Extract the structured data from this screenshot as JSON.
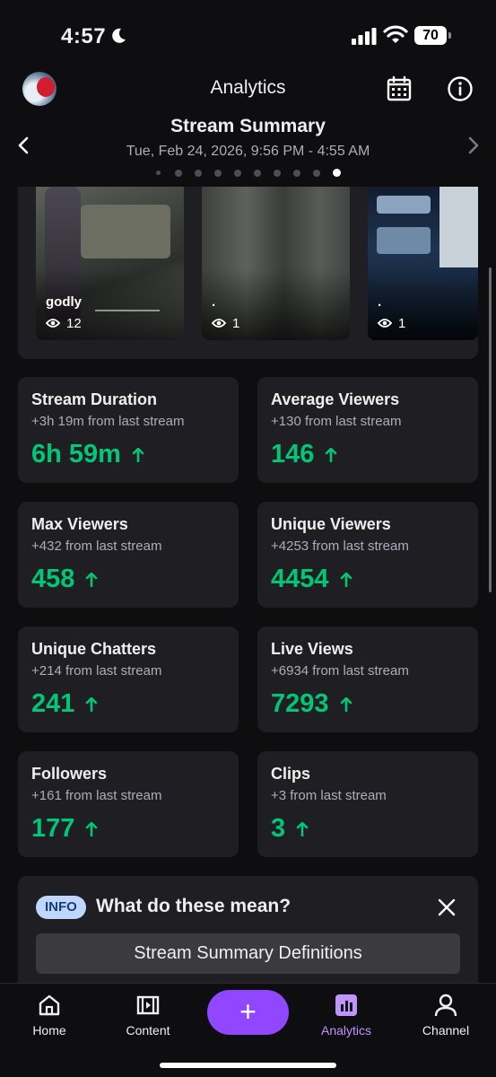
{
  "status_bar": {
    "time": "4:57",
    "battery": "70"
  },
  "header": {
    "title": "Analytics"
  },
  "summary": {
    "title": "Stream Summary",
    "date_range": "Tue, Feb 24, 2026, 9:56 PM - 4:55 AM",
    "page_count": 10,
    "active_page": 9
  },
  "clips": [
    {
      "caption": "godly",
      "views": "12"
    },
    {
      "caption": ".",
      "views": "1"
    },
    {
      "caption": ".",
      "views": "1"
    }
  ],
  "stats": [
    {
      "label": "Stream Duration",
      "delta": "+3h 19m from last stream",
      "value": "6h 59m"
    },
    {
      "label": "Average Viewers",
      "delta": "+130 from last stream",
      "value": "146"
    },
    {
      "label": "Max Viewers",
      "delta": "+432 from last stream",
      "value": "458"
    },
    {
      "label": "Unique Viewers",
      "delta": "+4253 from last stream",
      "value": "4454"
    },
    {
      "label": "Unique Chatters",
      "delta": "+214 from last stream",
      "value": "241"
    },
    {
      "label": "Live Views",
      "delta": "+6934 from last stream",
      "value": "7293"
    },
    {
      "label": "Followers",
      "delta": "+161 from last stream",
      "value": "177"
    },
    {
      "label": "Clips",
      "delta": "+3 from last stream",
      "value": "3"
    }
  ],
  "definitions": {
    "badge": "INFO",
    "question": "What do these mean?",
    "button": "Stream Summary Definitions"
  },
  "tabbar": {
    "home": "Home",
    "content": "Content",
    "create": "+",
    "analytics": "Analytics",
    "channel": "Channel"
  },
  "colors": {
    "background": "#0e0e10",
    "card": "#1f1f23",
    "positive": "#00c676",
    "accent": "#9147ff",
    "active_tab": "#bf94ff"
  }
}
